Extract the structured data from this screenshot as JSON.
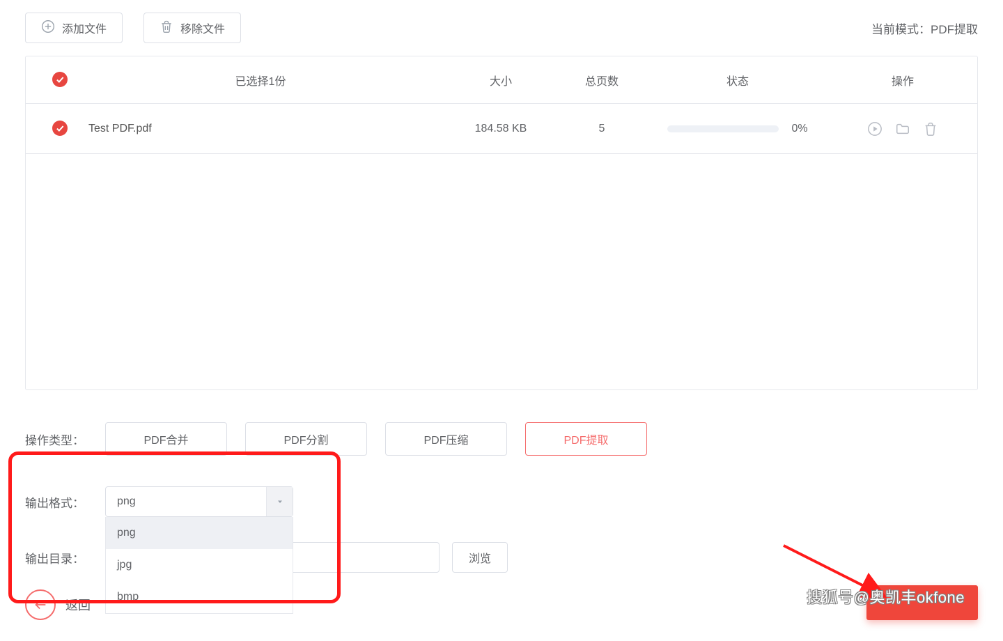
{
  "toolbar": {
    "add_file": "添加文件",
    "remove_file": "移除文件"
  },
  "mode": {
    "prefix": "当前模式：",
    "value": "PDF提取"
  },
  "table": {
    "header": {
      "selected_count": "已选择1份",
      "size": "大小",
      "pages": "总页数",
      "status": "状态",
      "action": "操作"
    },
    "row": {
      "name": "Test PDF.pdf",
      "size": "184.58 KB",
      "pages": "5",
      "progress_pct": "0%"
    }
  },
  "op_section": {
    "label": "操作类型：",
    "buttons": [
      "PDF合并",
      "PDF分割",
      "PDF压缩",
      "PDF提取"
    ],
    "active_index": 3
  },
  "output_format": {
    "label": "输出格式：",
    "selected": "png",
    "options": [
      "png",
      "jpg",
      "bmp"
    ]
  },
  "output_dir": {
    "label": "输出目录：",
    "value": "",
    "browse": "浏览"
  },
  "back_label": "返回",
  "watermark": "搜狐号@奥凯丰okfone"
}
